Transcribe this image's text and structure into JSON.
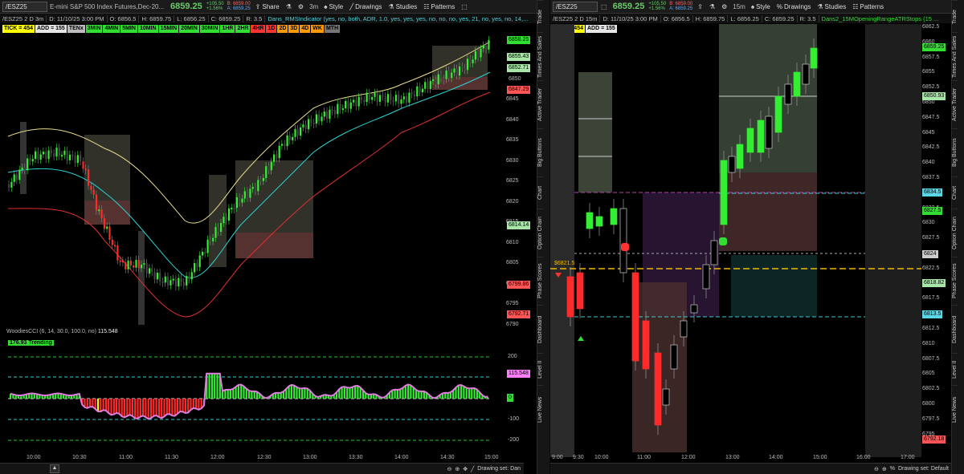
{
  "left": {
    "toolbar": {
      "symbol": "/ESZ25",
      "description": "E-mini S&P 500 Index Futures,Dec-20...",
      "last": "6859.25",
      "change": "+105.50",
      "change_pct": "+1.56%",
      "bid": "B: 6859.00",
      "ask": "A: 6859.25",
      "share": "Share",
      "style": "Style",
      "drawings": "Drawings",
      "studies": "Studies",
      "patterns": "Patterns",
      "timeframe": "3m"
    },
    "info": {
      "name": "/ESZ25 2 D 3m",
      "date": "D: 11/10/25 3:00 PM",
      "open": "O: 6856.5",
      "high": "H: 6859.75",
      "low": "L: 6856.25",
      "close": "C: 6859.25",
      "range": "R: 3.5",
      "study": "Dans_RMSIndicator (yes, no, both, ADR, 1.0, yes, yes, yes, no, no, no, yes, 21, no, yes, no, 14,..."
    },
    "tags": [
      {
        "t": "TICK = 454",
        "c": "#ffff00"
      },
      {
        "t": "ADD = 155",
        "c": "#e6e6e6"
      },
      {
        "t": "TENx",
        "c": "#bdbdbd"
      },
      {
        "t": "3MIN",
        "c": "#33dd33"
      },
      {
        "t": "4MIN",
        "c": "#33dd33"
      },
      {
        "t": "5MIN",
        "c": "#33dd33"
      },
      {
        "t": "10MIN",
        "c": "#33dd33"
      },
      {
        "t": "15MIN",
        "c": "#33dd33"
      },
      {
        "t": "20MIN",
        "c": "#33dd33"
      },
      {
        "t": "30MIN",
        "c": "#33dd33"
      },
      {
        "t": "1HR",
        "c": "#33dd33"
      },
      {
        "t": "2HR",
        "c": "#33dd33"
      },
      {
        "t": "4HR",
        "c": "#ff3333"
      },
      {
        "t": "1D",
        "c": "#ff3333"
      },
      {
        "t": "2D",
        "c": "#ff9900"
      },
      {
        "t": "3D",
        "c": "#ff9900"
      },
      {
        "t": "4D",
        "c": "#ff9900"
      },
      {
        "t": "WK",
        "c": "#ff9900"
      },
      {
        "t": "MTH",
        "c": "#777777"
      }
    ],
    "price_axis": [
      "6845",
      "6840",
      "6835",
      "6830",
      "6825",
      "6820",
      "6815",
      "6810",
      "6805",
      "6800",
      "6795",
      "6790"
    ],
    "labels": [
      {
        "t": "6858.25",
        "c": "#33dd33"
      },
      {
        "t": "6855.43",
        "c": "#a8e6a8"
      },
      {
        "t": "6852.71",
        "c": "#a8e6a8"
      },
      {
        "t": "6850",
        "c": ""
      },
      {
        "t": "6847.29",
        "c": "#ff5555"
      },
      {
        "t": "6814.14",
        "c": "#a8e6a8"
      },
      {
        "t": "6799.86",
        "c": "#ff5555"
      },
      {
        "t": "6792.71",
        "c": "#ff5555"
      }
    ],
    "time_axis": [
      "10:00",
      "10:30",
      "11:00",
      "11:30",
      "12:00",
      "12:30",
      "13:00",
      "13:30",
      "14:00",
      "14:30",
      "15:00"
    ],
    "cci": {
      "title": "WoodiesCCI (6, 14, 30.0, 100.0, no)",
      "value": "115.548",
      "status": "176.93 Trending",
      "axis": [
        "200",
        "100",
        "0",
        "-100",
        "-200"
      ],
      "label": "115.548"
    },
    "drawing_set": "Drawing set: Dan",
    "side_tabs": [
      "Trade",
      "Times And Sales",
      "Active Trader",
      "Big Buttons",
      "Chart",
      "Option Chain",
      "Phase Scores",
      "Dashboard",
      "Level II",
      "Live News"
    ]
  },
  "right": {
    "toolbar": {
      "symbol": "/ESZ25",
      "last": "6859.25",
      "change": "+105.50",
      "change_pct": "+1.56%",
      "bid": "B: 6859.00",
      "ask": "A: 6859.25",
      "timeframe": "15m",
      "style": "Style",
      "drawings": "Drawings",
      "studies": "Studies",
      "patterns": "Patterns"
    },
    "info": {
      "name": "/ESZ25 2 D 15m",
      "date": "D: 11/10/25 3:00 PM",
      "open": "O: 6856.5",
      "high": "H: 6859.75",
      "low": "L: 6856.25",
      "close": "C: 6859.25",
      "range": "R: 3.5",
      "study": "Dans2_15MOpeningRangeATRStops (15 ..."
    },
    "tags": [
      {
        "t": "TICK = 454",
        "c": "#ffff00"
      },
      {
        "t": "ADD = 155",
        "c": "#e6e6e6"
      }
    ],
    "price_axis": [
      "6862.5",
      "6860",
      "6857.5",
      "6855",
      "6852.5",
      "6850",
      "6847.5",
      "6845",
      "6842.5",
      "6840",
      "6837.5",
      "6835",
      "6832.5",
      "6830",
      "6827.5",
      "6825",
      "6822.5",
      "6820",
      "6817.5",
      "6815",
      "6812.5",
      "6810",
      "6807.5",
      "6805",
      "6802.5",
      "6800",
      "6797.5",
      "6795"
    ],
    "labels": [
      {
        "t": "6859.25",
        "c": "#33dd33"
      },
      {
        "t": "6850.93",
        "c": "#a8e6a8"
      },
      {
        "t": "6834.5",
        "c": "#5ad7e6"
      },
      {
        "t": "6827.5",
        "c": "#33dd33"
      },
      {
        "t": "6824",
        "c": "#cccccc"
      },
      {
        "t": "6818.82",
        "c": "#a8e6a8"
      },
      {
        "t": "6813.5",
        "c": "#5ad7e6"
      },
      {
        "t": "6792.18",
        "c": "#ff5555"
      }
    ],
    "level_label": "$6821.5",
    "time_axis": [
      "9:00",
      "9:30",
      "10:00",
      "11:00",
      "12:00",
      "13:00",
      "14:00",
      "15:00",
      "16:00",
      "17:00"
    ],
    "drawing_set": "Drawing set: Default",
    "side_tabs": [
      "Trade",
      "Times And Sales",
      "Active Trader",
      "Big Buttons",
      "Chart",
      "Option Chain",
      "Phase Scores",
      "Dashboard",
      "Level II",
      "Live News"
    ]
  }
}
